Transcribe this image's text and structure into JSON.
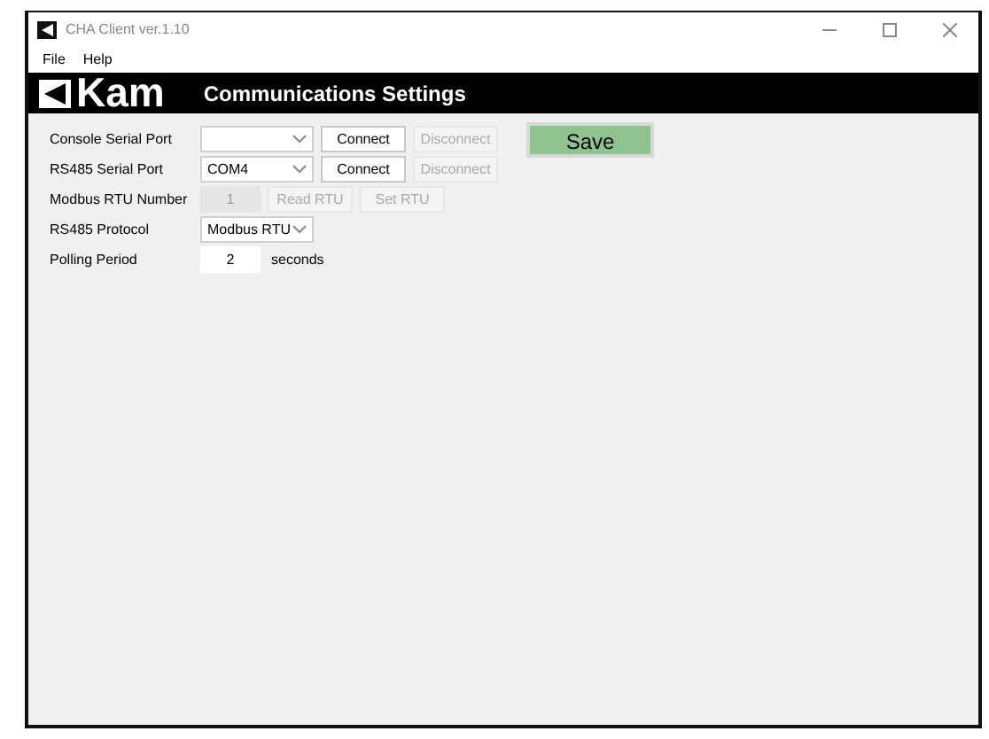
{
  "window": {
    "title": "CHA Client ver.1.10"
  },
  "menu": [
    "File",
    "Help"
  ],
  "header": {
    "logo": "Kam",
    "title": "Communications Settings"
  },
  "rows": [
    {
      "label": "Console Serial Port",
      "control": {
        "kind": "combo",
        "disabled": false
      },
      "buttons": [
        {
          "label": "Connect",
          "disabled": false
        },
        {
          "label": "Disconnect",
          "disabled": true
        }
      ]
    },
    {
      "label": "RS485 Serial Port",
      "control": {
        "kind": "combo",
        "value": "COM4",
        "disabled": false
      },
      "buttons": [
        {
          "label": "Connect",
          "disabled": false
        },
        {
          "label": "Disconnect",
          "disabled": true
        }
      ]
    },
    {
      "label": "Modbus RTU Number",
      "control": {
        "kind": "number",
        "value": "1",
        "disabled": true
      },
      "buttons": [
        {
          "label": "Read RTU",
          "disabled": true
        },
        {
          "label": "Set RTU",
          "disabled": true
        }
      ]
    },
    {
      "label": "RS485 Protocol",
      "control": {
        "kind": "combo",
        "value": "Modbus RTU",
        "disabled": false
      }
    },
    {
      "label": "Polling Period",
      "control": {
        "kind": "number",
        "value": "2",
        "disabled": false
      },
      "suffix": "seconds"
    }
  ],
  "save": {
    "label": "Save"
  }
}
